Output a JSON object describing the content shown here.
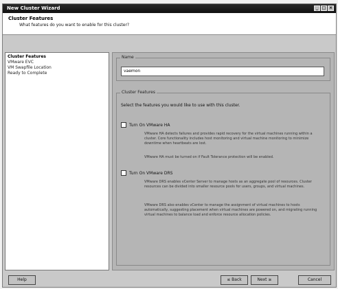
{
  "window": {
    "title": "New Cluster Wizard",
    "controls": [
      "_",
      "□",
      "×"
    ]
  },
  "header": {
    "title": "Cluster Features",
    "subtitle": "What features do you want to enable for this cluster?"
  },
  "steps": [
    {
      "label": "Cluster Features",
      "active": true
    },
    {
      "label": "VMware EVC",
      "active": false
    },
    {
      "label": "VM Swapfile Location",
      "active": false
    },
    {
      "label": "Ready to Complete",
      "active": false
    }
  ],
  "name_group": {
    "label": "Name",
    "value": "vaemon"
  },
  "features": {
    "group_label": "Cluster Features",
    "intro": "Select the features you would like to use with this cluster.",
    "ha": {
      "label": "Turn On VMware HA",
      "checked": false,
      "desc1": "VMware HA detects failures and provides rapid recovery for the virtual machines running within a cluster. Core functionality includes host monitoring and virtual machine monitoring to minimize downtime when heartbeats are lost.",
      "desc2": "VMware HA must be turned on if Fault Tolerance protection will be enabled."
    },
    "drs": {
      "label": "Turn On VMware DRS",
      "checked": false,
      "desc1": "VMware DRS enables vCenter Server to manage hosts as an aggregate pool of resources. Cluster resources can be divided into smaller resource pools for users, groups, and virtual machines.",
      "desc2": "VMware DRS also enables vCenter to manage the assignment of virtual machines to hosts automatically, suggesting placement when virtual machines are powered on, and migrating running virtual machines to balance load and enforce resource allocation policies."
    }
  },
  "buttons": {
    "help": "Help",
    "back": "≤ Back",
    "next": "Next ≥",
    "cancel": "Cancel"
  }
}
